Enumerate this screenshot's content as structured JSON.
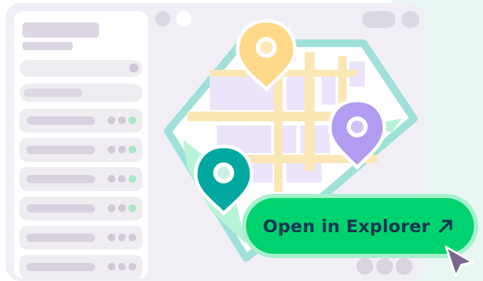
{
  "cta": {
    "label": "Open in Explorer",
    "arrow_icon": "arrow-up-right-icon"
  },
  "sidebar": {
    "rows": [
      {
        "active": true
      },
      {
        "active": true
      },
      {
        "active": true
      },
      {
        "active": true
      },
      {
        "active": false
      },
      {
        "active": false
      }
    ]
  },
  "colors": {
    "window_bg": "#f1eff5",
    "cta_green": "#00d26f",
    "cta_glow": "#a6f0cd",
    "cta_text": "#163552",
    "pin_yellow": "#ffd98a",
    "pin_purple": "#b19cf1",
    "pin_teal": "#00a8a0",
    "map_outline": "#9fe1d8",
    "map_road": "#fbe7b5",
    "map_block": "#ece4fb",
    "cursor": "#7a6790"
  },
  "icons": {
    "pin_yellow": "map-pin-icon",
    "pin_purple": "map-pin-icon",
    "pin_teal": "map-pin-icon",
    "cursor": "mouse-pointer-icon"
  }
}
